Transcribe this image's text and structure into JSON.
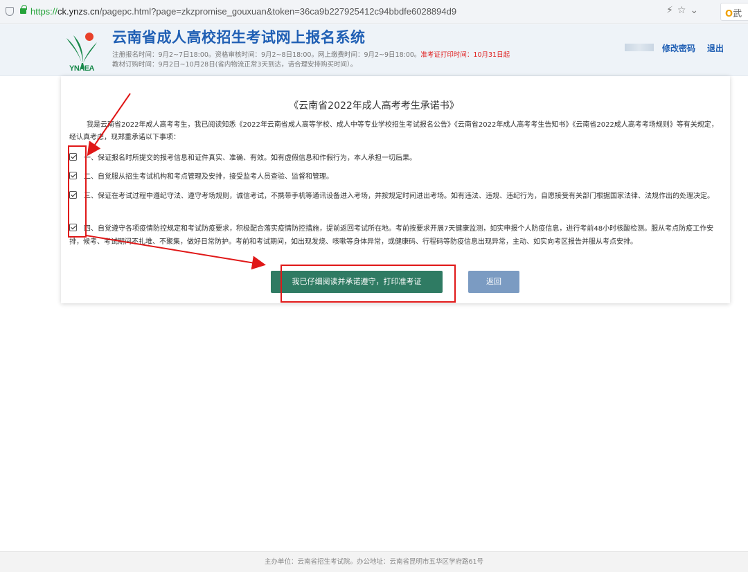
{
  "browser": {
    "url_scheme": "https://",
    "url_host": "ck.ynzs.cn",
    "url_path": "/pagepc.html?page=zkzpromise_gouxuan&token=36ca9b227925412c94bbdfe6028894d9",
    "search_label": "武"
  },
  "header": {
    "logo_text": "YNAEA",
    "site_title": "云南省成人高校招生考试网上报名系统",
    "notice_line1": "注册报名时间：9月2~7日18:00。资格审核时间：9月2~8日18:00。网上缴费时间：9月2~9日18:00。",
    "notice_line1_red": "准考证打印时间：10月31日起",
    "notice_line2": "教材订购时间：9月2日~10月28日(省内物流正常3天到达，请合理安排购买时间）。",
    "change_password": "修改密码",
    "logout": "退出"
  },
  "promise": {
    "title": "《云南省2022年成人高考考生承诺书》",
    "intro": "我是云南省2022年成人高考考生，我已阅读知悉《2022年云南省成人高等学校、成人中等专业学校招生考试报名公告》《云南省2022年成人高考考生告知书》《云南省2022成人高考考场规则》等有关规定，经认真考虑，现郑重承诺以下事项：",
    "items": [
      "一、保证报名时所提交的报考信息和证件真实、准确、有效。如有虚假信息和作假行为，本人承担一切后果。",
      "二、自觉服从招生考试机构和考点管理及安排，接受监考人员查验、监督和管理。",
      "三、保证在考试过程中遵纪守法、遵守考场规则，诚信考试，不携带手机等通讯设备进入考场，并按规定时间进出考场。如有违法、违规、违纪行为，自愿接受有关部门根据国家法律、法规作出的处理决定。",
      "四、自觉遵守各项疫情防控规定和考试防疫要求，积极配合落实疫情防控措施，提前返回考试所在地。考前按要求开展7天健康监测，如实申报个人防疫信息，进行考前48小时核酸检测。服从考点防疫工作安排，候考、考试期间不扎堆、不聚集，做好日常防护。考前和考试期间，如出现发烧、咳嗽等身体异常，或健康码、行程码等防疫信息出现异常，主动、如实向考区报告并服从考点安排。"
    ],
    "confirm_button": "我已仔细阅读并承诺遵守，打印准考证",
    "back_button": "返回"
  },
  "footer": {
    "text": "主办单位：云南省招生考试院。办公地址：云南省昆明市五华区学府路61号"
  },
  "colors": {
    "title_blue": "#1f5fb4",
    "confirm_green": "#2f7b63",
    "back_blue": "#7b9bc2",
    "annotation_red": "#e01818",
    "notice_red": "#e02020"
  }
}
